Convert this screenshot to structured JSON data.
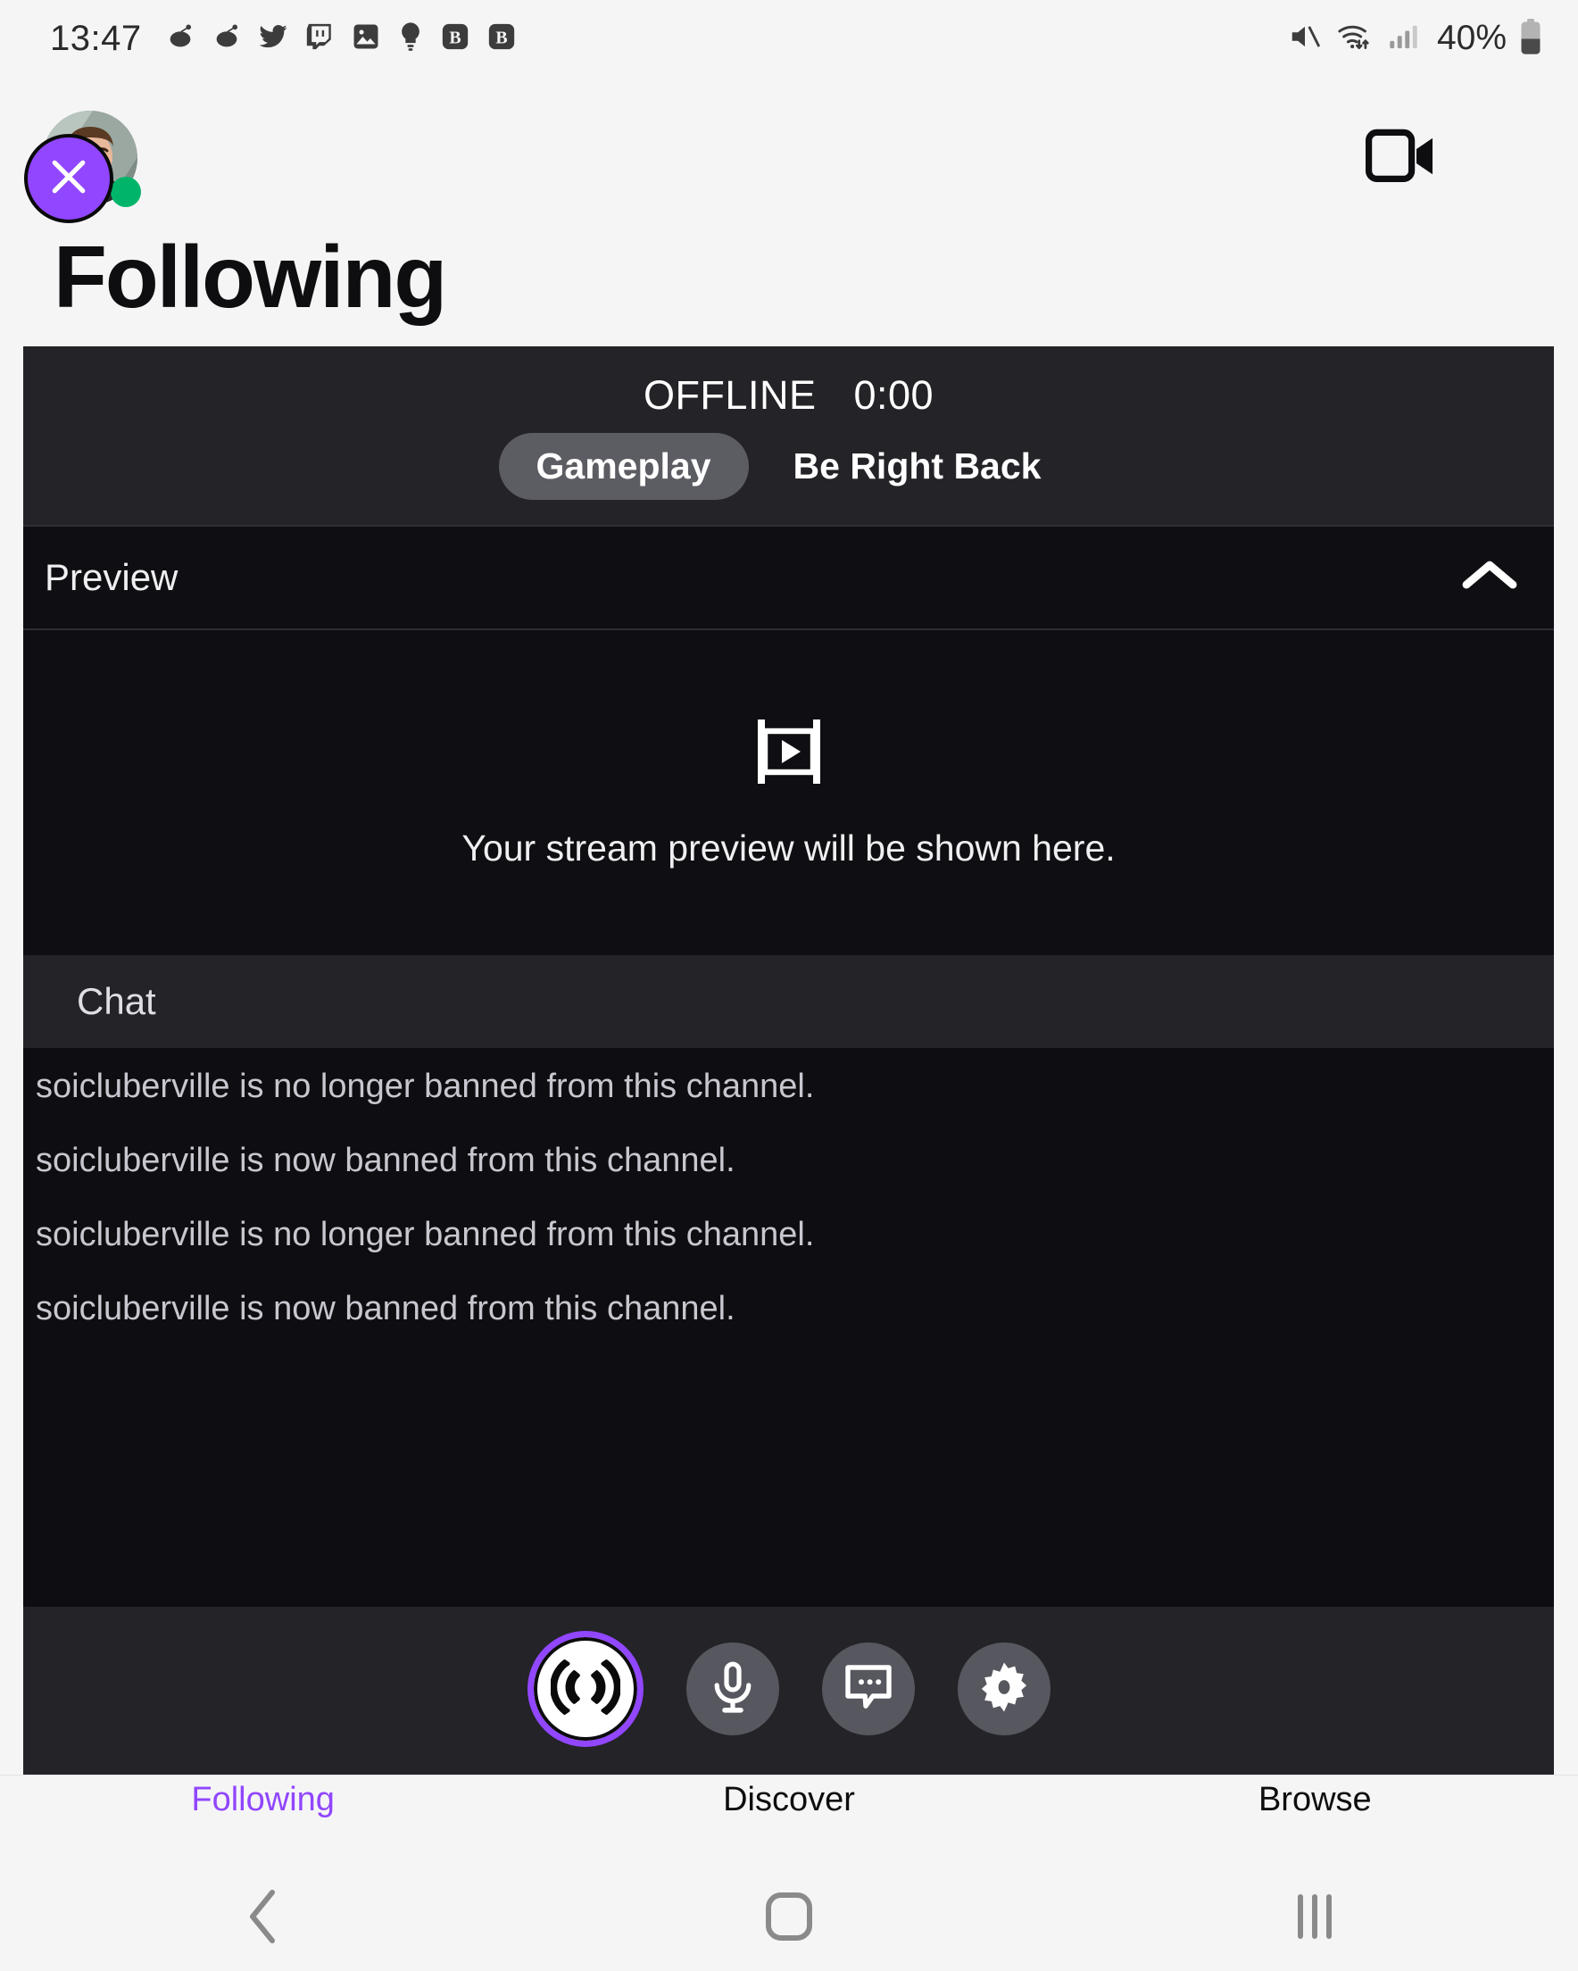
{
  "status_bar": {
    "time": "13:47",
    "battery_percent": "40%",
    "left_icons": [
      "reddit-icon",
      "reddit-icon",
      "twitter-icon",
      "twitch-icon",
      "gallery-icon",
      "lightbulb-icon",
      "bitwarden-badge-icon",
      "bitwarden-badge-icon"
    ],
    "right_icons": [
      "mute-icon",
      "wifi-transfer-icon",
      "cell-signal-icon",
      "battery-icon"
    ]
  },
  "app": {
    "page_title": "Following",
    "camera_icon": "video-camera-icon",
    "avatar_icon": "user-avatar",
    "online_status": "online",
    "close_fab_icon": "close-icon"
  },
  "panel": {
    "stream_status": "OFFLINE",
    "stream_timer": "0:00",
    "tabs": [
      {
        "label": "Gameplay",
        "active": true
      },
      {
        "label": "Be Right Back",
        "active": false
      }
    ],
    "preview": {
      "title": "Preview",
      "collapse_icon": "chevron-up-icon",
      "placeholder_icon": "video-frame-play-icon",
      "caption": "Your stream preview will be shown here."
    },
    "chat": {
      "title": "Chat",
      "messages": [
        "soicluberville is no longer banned from this channel.",
        "soicluberville is now banned from this channel.",
        "soicluberville is no longer banned from this channel.",
        "soicluberville is now banned from this channel."
      ]
    },
    "controls": [
      {
        "name": "go-live-button",
        "icon": "broadcast-icon",
        "primary": true
      },
      {
        "name": "microphone-button",
        "icon": "microphone-icon",
        "primary": false
      },
      {
        "name": "chat-toggle-button",
        "icon": "chat-bubble-icon",
        "primary": false
      },
      {
        "name": "settings-button",
        "icon": "gear-icon",
        "primary": false
      }
    ]
  },
  "bottom_nav": [
    {
      "label": "Following",
      "active": true
    },
    {
      "label": "Discover",
      "active": false
    },
    {
      "label": "Browse",
      "active": false
    }
  ],
  "system_nav": {
    "back_icon": "back-chevron-icon",
    "home_icon": "home-square-icon",
    "recents_icon": "recents-bars-icon"
  },
  "colors": {
    "accent_purple": "#9146ff",
    "panel_bg": "#232328",
    "panel_dark": "#0f0e12",
    "chat_bg": "#0e0d11",
    "online_green": "#00b56a",
    "page_bg": "#f5f5f6"
  }
}
